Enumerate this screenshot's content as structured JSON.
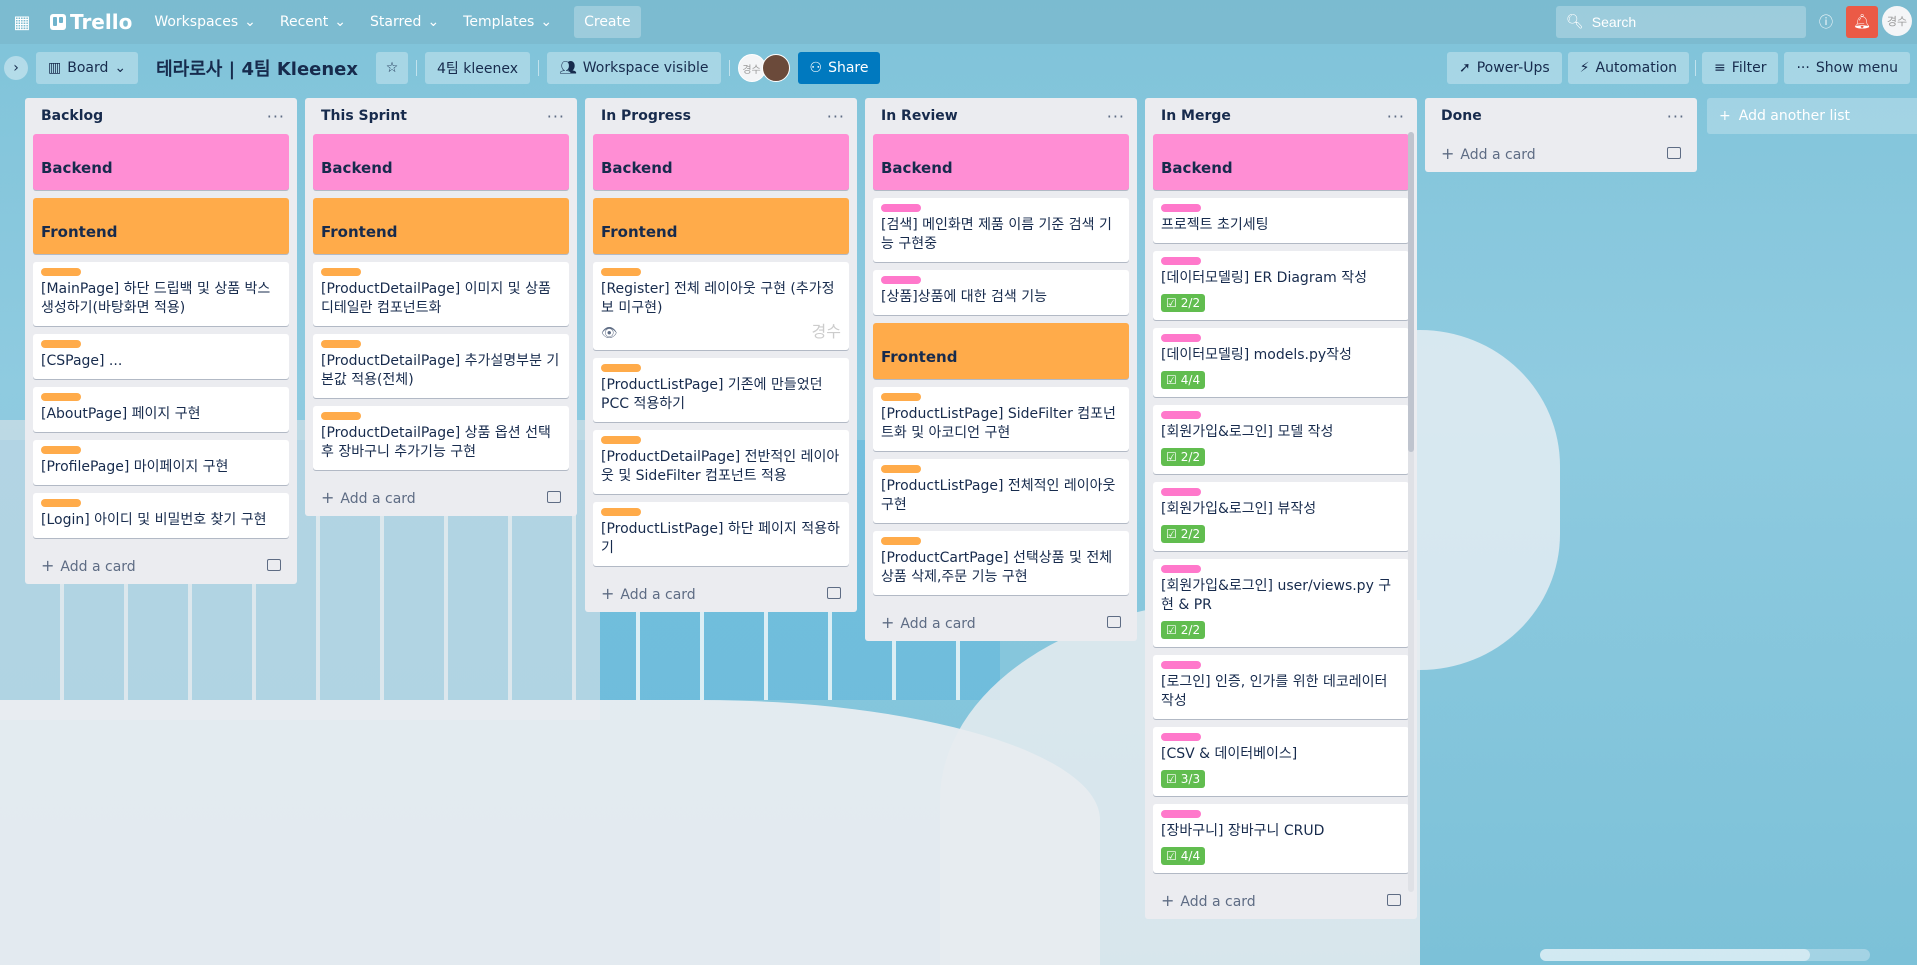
{
  "topbar": {
    "logo": "Trello",
    "nav": [
      "Workspaces",
      "Recent",
      "Starred",
      "Templates"
    ],
    "create": "Create",
    "search_placeholder": "Search",
    "user_initials": "경수"
  },
  "board": {
    "view": "Board",
    "title": "테라로사 | 4팀 Kleenex",
    "workspace": "4팀 kleenex",
    "visibility": "Workspace visible",
    "avatar1": "경수",
    "share": "Share",
    "power_ups": "Power-Ups",
    "automation": "Automation",
    "filter": "Filter",
    "show_menu": "Show menu"
  },
  "add_card": "Add a card",
  "add_list": "Add another list",
  "lists": [
    {
      "title": "Backlog",
      "cards": [
        {
          "type": "cover",
          "color": "#ff8ed4",
          "text": "Backend"
        },
        {
          "type": "cover",
          "color": "#ffab4a",
          "text": "Frontend"
        },
        {
          "label": "orange",
          "text": "[MainPage] 하단 드립백 및 상품 박스 생성하기(바탕화면 적용)"
        },
        {
          "label": "orange",
          "text": "[CSPage] ..."
        },
        {
          "label": "orange",
          "text": "[AboutPage] 페이지 구현"
        },
        {
          "label": "orange",
          "text": "[ProfilePage] 마이페이지 구현"
        },
        {
          "label": "orange",
          "text": "[Login] 아이디 및 비밀번호 찾기 구현"
        }
      ]
    },
    {
      "title": "This Sprint",
      "cards": [
        {
          "type": "cover",
          "text": "Backend"
        },
        {
          "type": "cover",
          "text": "Frontend"
        },
        {
          "label": "orange",
          "text": "[ProductDetailPage] 이미지 및 상품디테일란 컴포넌트화"
        },
        {
          "label": "orange",
          "text": "[ProductDetailPage] 추가설명부분 기본값 적용(전체)"
        },
        {
          "label": "orange",
          "text": "[ProductDetailPage] 상품 옵션 선택 후 장바구니 추가기능 구현"
        }
      ]
    },
    {
      "title": "In Progress",
      "cards": [
        {
          "type": "cover",
          "text": "Backend"
        },
        {
          "type": "cover",
          "text": "Frontend"
        },
        {
          "label": "orange",
          "text": "[Register] 전체 레이아웃 구현 (추가정보 미구현)",
          "watch": true,
          "member": "경수"
        },
        {
          "label": "orange",
          "text": "[ProductListPage] 기존에 만들었던 PCC 적용하기"
        },
        {
          "label": "orange",
          "text": "[ProductDetailPage] 전반적인 레이아웃 및 SideFilter 컴포넌트 적용"
        },
        {
          "label": "orange",
          "text": "[ProductListPage] 하단 페이지 적용하기"
        }
      ]
    },
    {
      "title": "In Review",
      "cards": [
        {
          "type": "cover",
          "text": "Backend"
        },
        {
          "label": "pink",
          "text": "[검색] 메인화면 제품 이름 기준 검색 기능 구현중"
        },
        {
          "label": "pink",
          "text": "[상품]상품에 대한 검색 기능"
        },
        {
          "type": "cover",
          "text": "Frontend"
        },
        {
          "label": "orange",
          "text": "[ProductListPage] SideFilter 컴포넌트화 및 아코디언 구현"
        },
        {
          "label": "orange",
          "text": "[ProductListPage] 전체적인 레이아웃 구현"
        },
        {
          "label": "orange",
          "text": "[ProductCartPage] 선택상품 및 전체상품 삭제,주문 기능 구현"
        }
      ]
    },
    {
      "title": "In Merge",
      "cards": [
        {
          "type": "cover",
          "text": "Backend"
        },
        {
          "label": "pink",
          "text": "프로젝트 초기세팅"
        },
        {
          "label": "pink",
          "text": "[데이터모델링] ER Diagram 작성",
          "checklist": "2/2"
        },
        {
          "label": "pink",
          "text": "[데이터모델링] models.py작성",
          "checklist": "4/4"
        },
        {
          "label": "pink",
          "text": "[회원가입&로그인] 모델 작성",
          "checklist": "2/2"
        },
        {
          "label": "pink",
          "text": "[회원가입&로그인] 뷰작성",
          "checklist": "2/2"
        },
        {
          "label": "pink",
          "text": "[회원가입&로그인] user/views.py 구현 & PR",
          "checklist": "2/2"
        },
        {
          "label": "pink",
          "text": "[로그인] 인증, 인가를 위한 데코레이터 작성"
        },
        {
          "label": "pink",
          "text": "[CSV & 데이터베이스]",
          "checklist": "3/3"
        },
        {
          "label": "pink",
          "text": "[장바구니] 장바구니 CRUD",
          "checklist": "4/4"
        }
      ]
    },
    {
      "title": "Done",
      "cards": []
    }
  ]
}
